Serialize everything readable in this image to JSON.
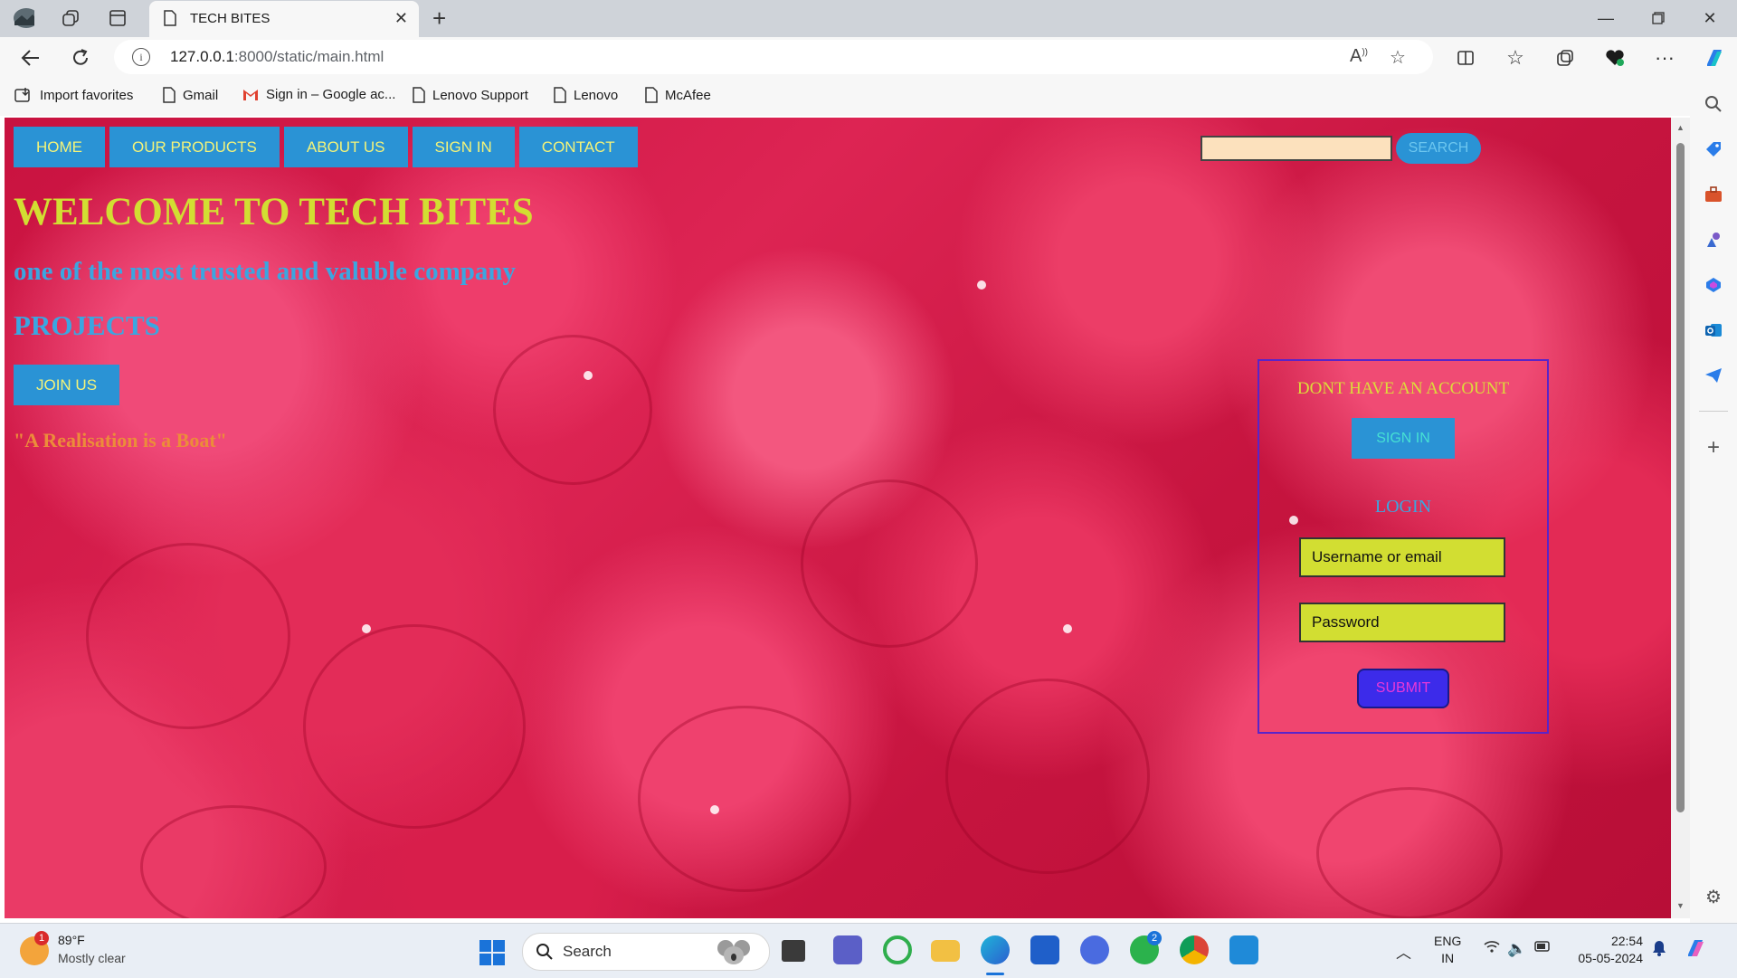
{
  "browser": {
    "tab_title": "TECH BITES",
    "url_host": "127.0.0.1",
    "url_rest": ":8000/static/main.html",
    "favorites": [
      "Import favorites",
      "Gmail",
      "Sign in – Google ac...",
      "Lenovo Support",
      "Lenovo",
      "McAfee"
    ]
  },
  "page": {
    "nav": [
      "HOME",
      "OUR PRODUCTS",
      "ABOUT US",
      "SIGN IN",
      "CONTACT"
    ],
    "search_button": "SEARCH",
    "welcome": "WELCOME TO TECH BITES",
    "tagline": "one of the most trusted and valuble company",
    "projects": "PROJECTS",
    "join_button": "JOIN US",
    "quote": "\"A Realisation is a Boat\"",
    "login_box": {
      "heading": "DONT HAVE AN ACCOUNT",
      "signin_button": "SIGN IN",
      "login_title": "LOGIN",
      "username_placeholder": "Username or email",
      "password_placeholder": "Password",
      "submit_button": "SUBMIT"
    }
  },
  "taskbar": {
    "weather_badge": "1",
    "weather_temp": "89°F",
    "weather_desc": "Mostly clear",
    "search_label": "Search",
    "whatsapp_badge": "2",
    "lang_line1": "ENG",
    "lang_line2": "IN",
    "time": "22:54",
    "date": "05-05-2024"
  },
  "colors": {
    "nav_bg": "#2a93d5",
    "nav_text": "#f3f37a",
    "welcome": "#d2de32",
    "tagline": "#3ba6e0",
    "quote": "#ec8c3a",
    "login_border": "#5a24c8",
    "submit_bg": "#3c2bea"
  }
}
